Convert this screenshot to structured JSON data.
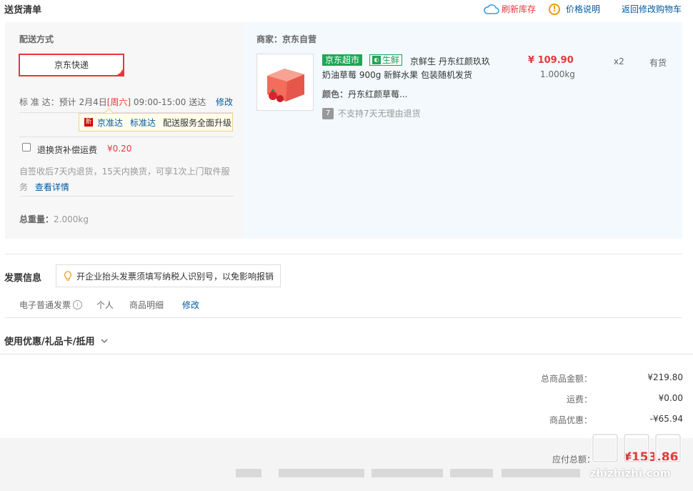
{
  "header": {
    "title": "送货清单",
    "refresh_stock": "刷新库存",
    "price_explain": "价格说明",
    "back_to_cart": "返回修改购物车"
  },
  "shipping": {
    "label": "配送方式",
    "method": "京东快递",
    "standard_prefix": "标 准 达：预计 2月4日",
    "standard_day": "[周六]",
    "standard_suffix": " 09:00-15:00 送达",
    "edit": "修改",
    "tip_new": "新",
    "tip_a": "京准达",
    "tip_b": "标准达",
    "tip_c": "配送服务全面升级",
    "insurance_label": "退换货补偿运费",
    "insurance_price": "¥0.20",
    "return_note": "自签收后7天内退货，15天内换货，可享1次上门取件服务",
    "return_more": "查看详情",
    "weight_label": "总重量：",
    "weight_value": "2.000kg"
  },
  "product": {
    "merchant": "商家：京东自营",
    "tag_supermarket": "京东超市",
    "tag_fresh": "生鲜",
    "name_line1": "京鲜生 丹东红颜玖玖",
    "name_line2": "奶油草莓 900g 新鲜水果 包装随机发货",
    "color_label": "颜色：",
    "color_value": "丹东红颜草莓...",
    "no_return_icon": "7",
    "no_return": "不支持7天无理由退货",
    "price": "¥ 109.90",
    "weight": "1.000kg",
    "qty": "x2",
    "stock": "有货"
  },
  "invoice": {
    "title": "发票信息",
    "tip": "开企业抬头发票须填写纳税人识别号，以免影响报销",
    "type": "电子普通发票",
    "person": "个人",
    "detail": "商品明细",
    "edit": "修改"
  },
  "coupon": {
    "title": "使用优惠/礼品卡/抵用"
  },
  "totals": {
    "goods_label": "总商品金额：",
    "goods_value": "¥219.80",
    "freight_label": "运费：",
    "freight_value": "¥0.00",
    "discount_label": "商品优惠：",
    "discount_value": "-¥65.94",
    "pay_label": "应付总额：",
    "pay_value": "¥153.86"
  },
  "watermark": {
    "text": "zhizhizhi.com",
    "logo": "值值值"
  },
  "colors": {
    "accent_red": "#e4393c",
    "link_blue": "#005aa0",
    "fresh_green": "#1ea755",
    "warn_orange": "#f39800"
  }
}
